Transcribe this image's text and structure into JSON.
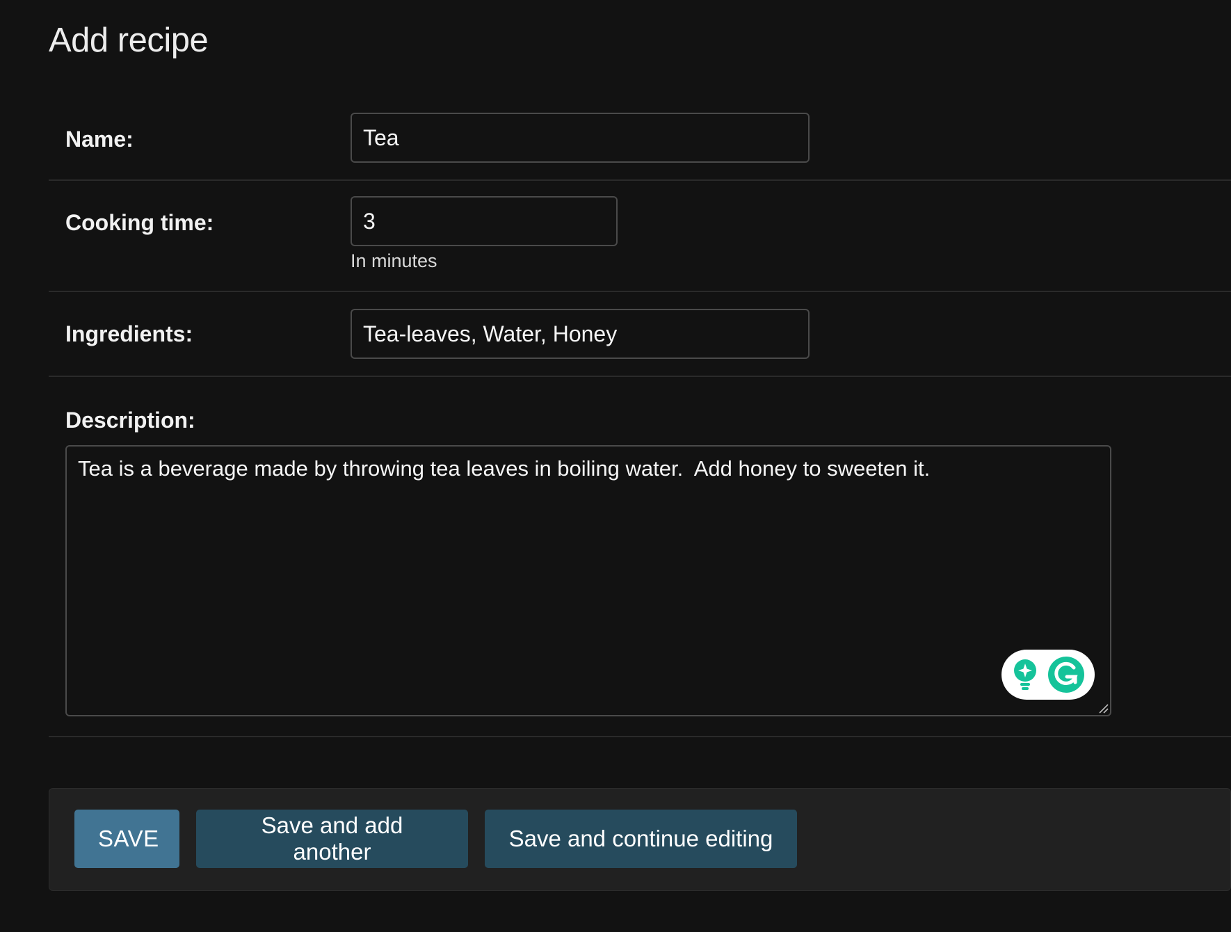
{
  "page": {
    "title": "Add recipe"
  },
  "form": {
    "name": {
      "label": "Name:",
      "value": "Tea"
    },
    "cooking_time": {
      "label": "Cooking time:",
      "value": "3",
      "help": "In minutes"
    },
    "ingredients": {
      "label": "Ingredients:",
      "value": "Tea-leaves, Water, Honey"
    },
    "description": {
      "label": "Description:",
      "value": "Tea is a beverage made by throwing tea leaves in boiling water.  Add honey to sweeten it."
    }
  },
  "actions": {
    "save_label": "SAVE",
    "save_add_another_label": "Save and add another",
    "save_continue_label": "Save and continue editing"
  },
  "widgets": {
    "grammarly_icons": [
      "lightbulb-icon",
      "grammarly-icon"
    ]
  },
  "colors": {
    "background": "#121212",
    "primary_button": "#417493",
    "secondary_button": "#264b5d",
    "grammarly_green": "#15c39a"
  }
}
